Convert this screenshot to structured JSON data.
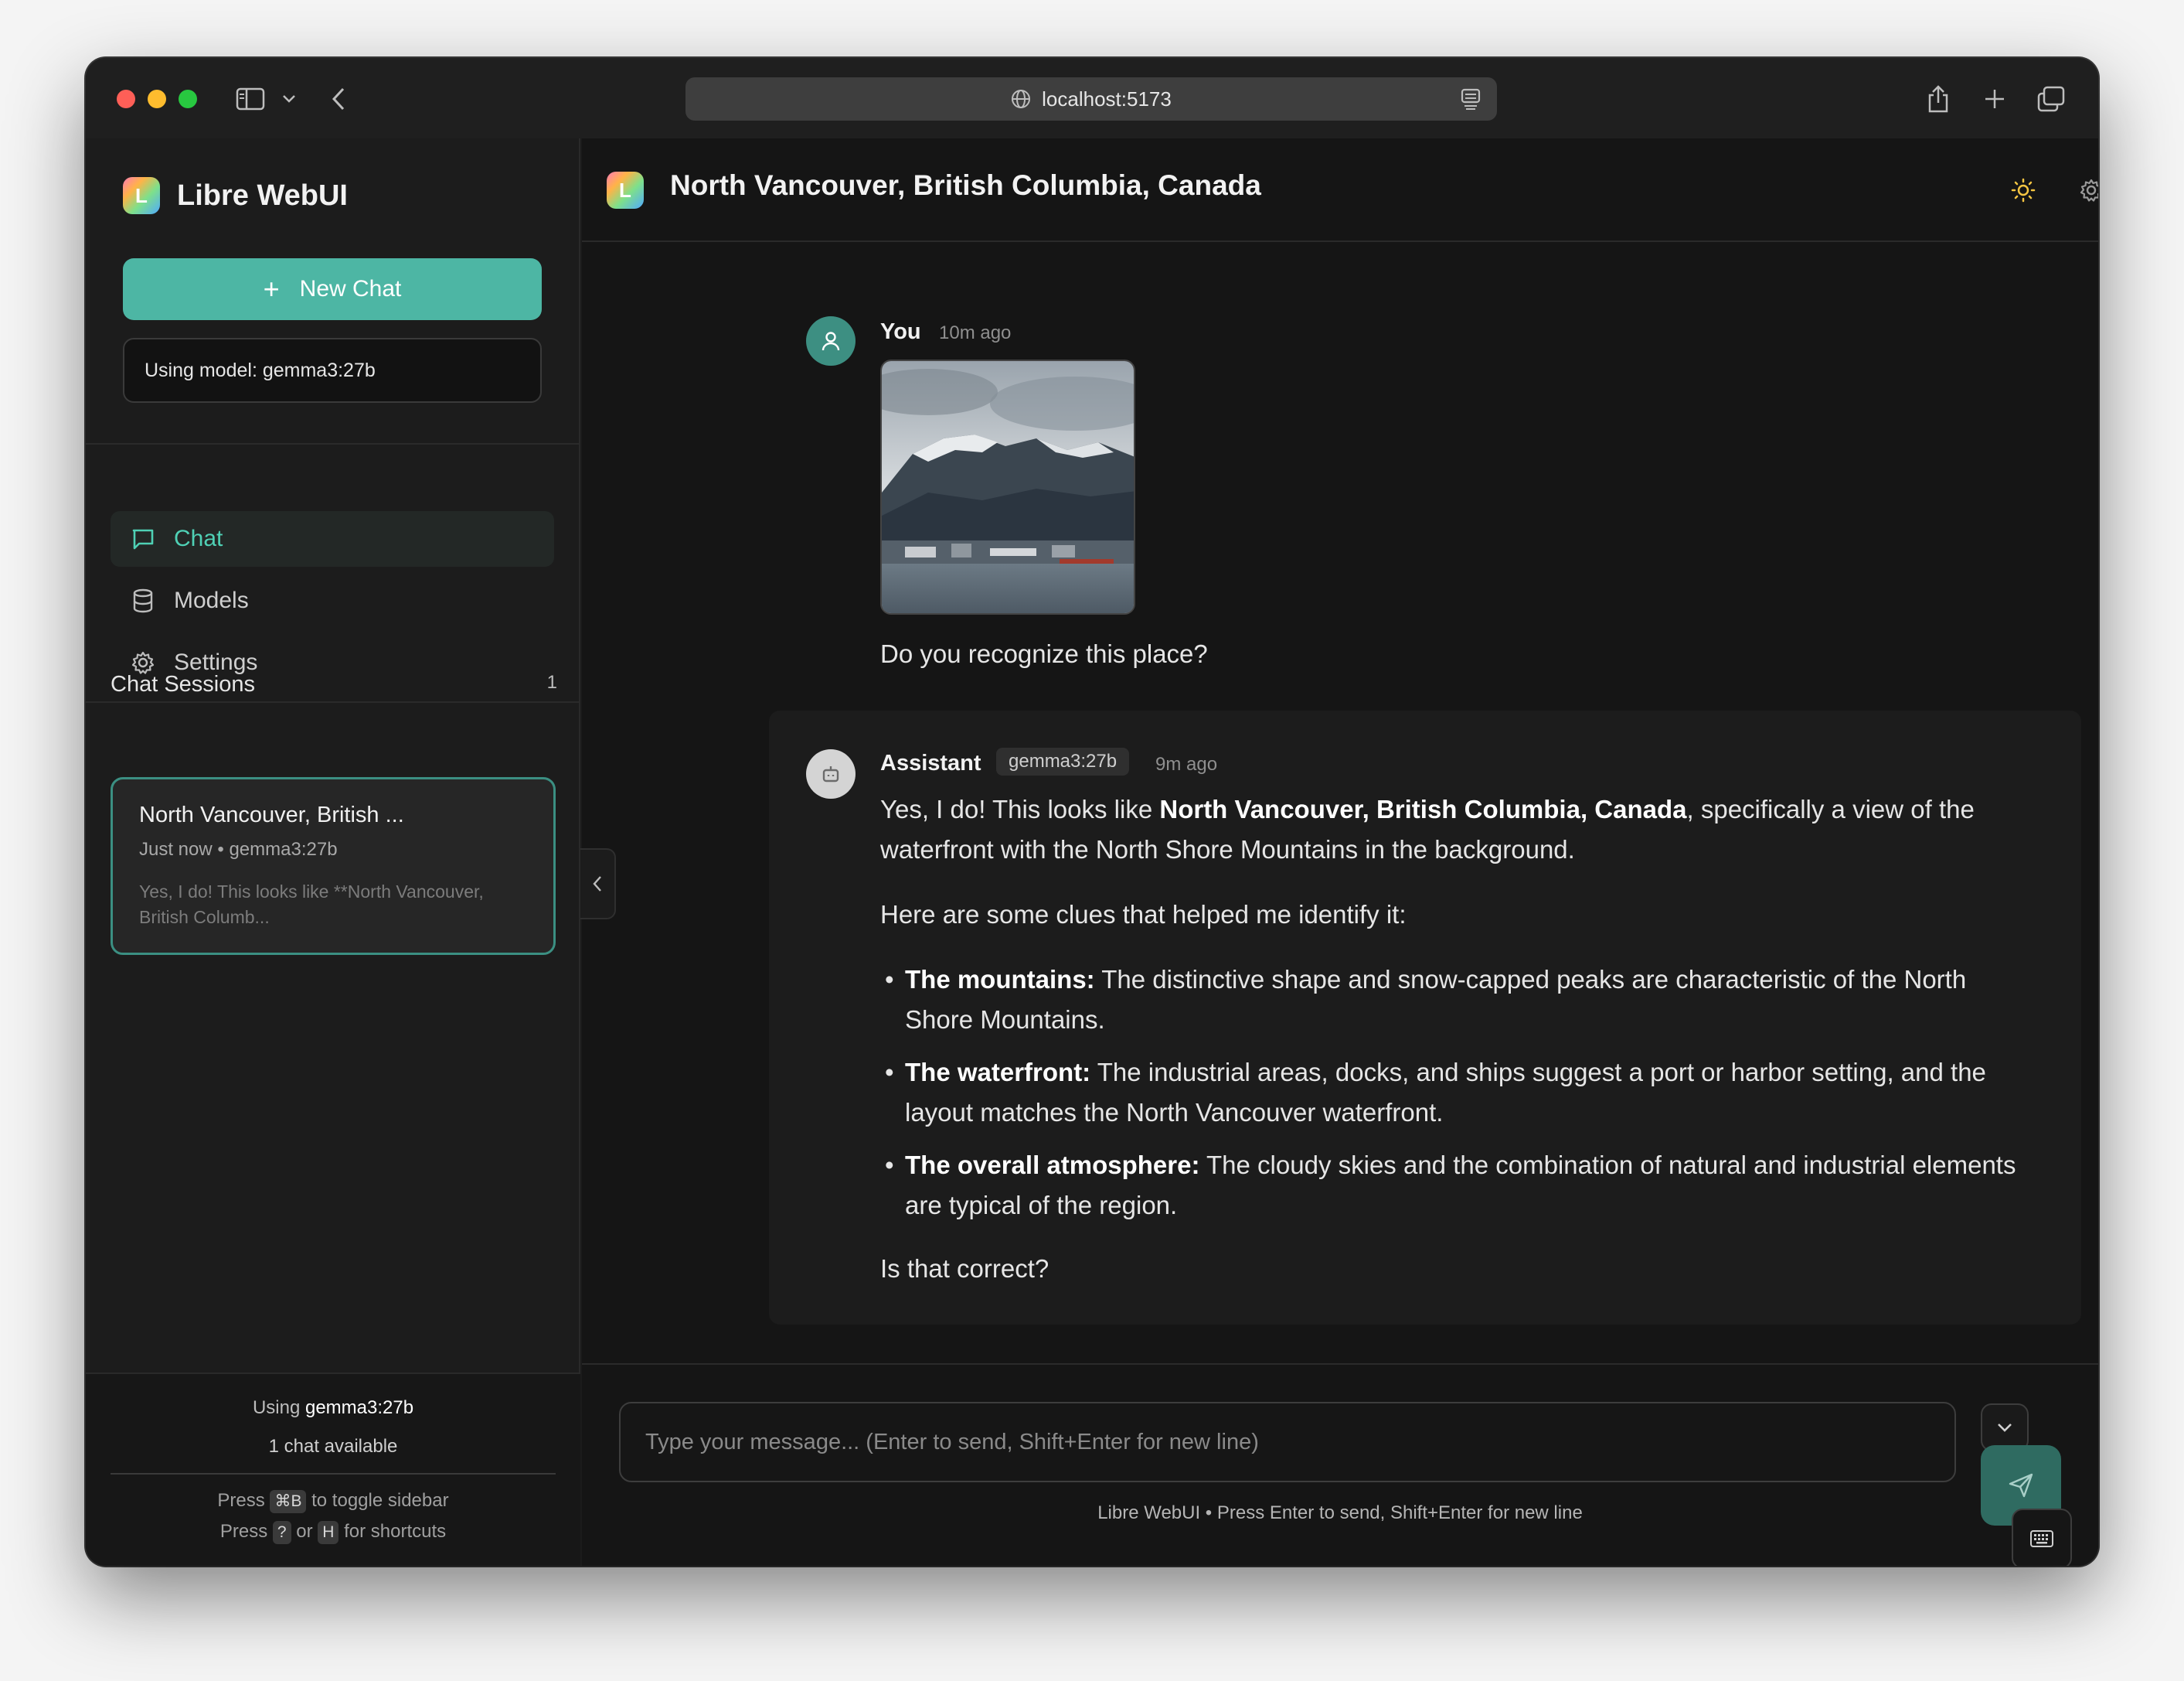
{
  "browser": {
    "url": "localhost:5173"
  },
  "sidebar": {
    "app_name": "Libre WebUI",
    "logo_letter": "L",
    "new_chat_label": "New Chat",
    "model_box": "Using model: gemma3:27b",
    "nav": [
      {
        "label": "Chat",
        "icon": "chat-bubble-icon",
        "active": true
      },
      {
        "label": "Models",
        "icon": "database-icon",
        "active": false
      },
      {
        "label": "Settings",
        "icon": "gear-icon",
        "active": false
      }
    ],
    "sessions_heading": "Chat Sessions",
    "sessions_count": "1",
    "session": {
      "title": "North Vancouver, British ...",
      "meta": "Just now • gemma3:27b",
      "preview": "Yes, I do! This looks like **North Vancouver, British Columb..."
    },
    "footer": {
      "using_prefix": "Using ",
      "using_model": "gemma3:27b",
      "available": "1 chat available",
      "hint1_pre": "Press",
      "hint1_key": "⌘B",
      "hint1_post": "to toggle sidebar",
      "hint2_pre": "Press",
      "hint2_key1": "?",
      "hint2_or": "or",
      "hint2_key2": "H",
      "hint2_post": "for shortcuts"
    }
  },
  "header": {
    "title": "North Vancouver, British Columbia, Canada"
  },
  "messages": {
    "user": {
      "author": "You",
      "time": "10m ago",
      "text": "Do you recognize this place?"
    },
    "assistant": {
      "author": "Assistant",
      "model": "gemma3:27b",
      "time": "9m ago",
      "p1_pre": "Yes, I do! This looks like ",
      "p1_bold": "North Vancouver, British Columbia, Canada",
      "p1_post": ", specifically a view of the waterfront with the North Shore Mountains in the background.",
      "p2": "Here are some clues that helped me identify it:",
      "bullets": [
        {
          "bold": "The mountains:",
          "text": " The distinctive shape and snow-capped peaks are characteristic of the North Shore Mountains."
        },
        {
          "bold": "The waterfront:",
          "text": " The industrial areas, docks, and ships suggest a port or harbor setting, and the layout matches the North Vancouver waterfront."
        },
        {
          "bold": "The overall atmosphere:",
          "text": " The cloudy skies and the combination of natural and industrial elements are typical of the region."
        }
      ],
      "closing": "Is that correct?"
    }
  },
  "composer": {
    "placeholder": "Type your message... (Enter to send, Shift+Enter for new line)",
    "footer_note": "Libre WebUI • Press Enter to send, Shift+Enter for new line"
  },
  "colors": {
    "accent": "#4db6a4",
    "active_nav_text": "#4fd1b5",
    "background": "#1b1b1b"
  }
}
